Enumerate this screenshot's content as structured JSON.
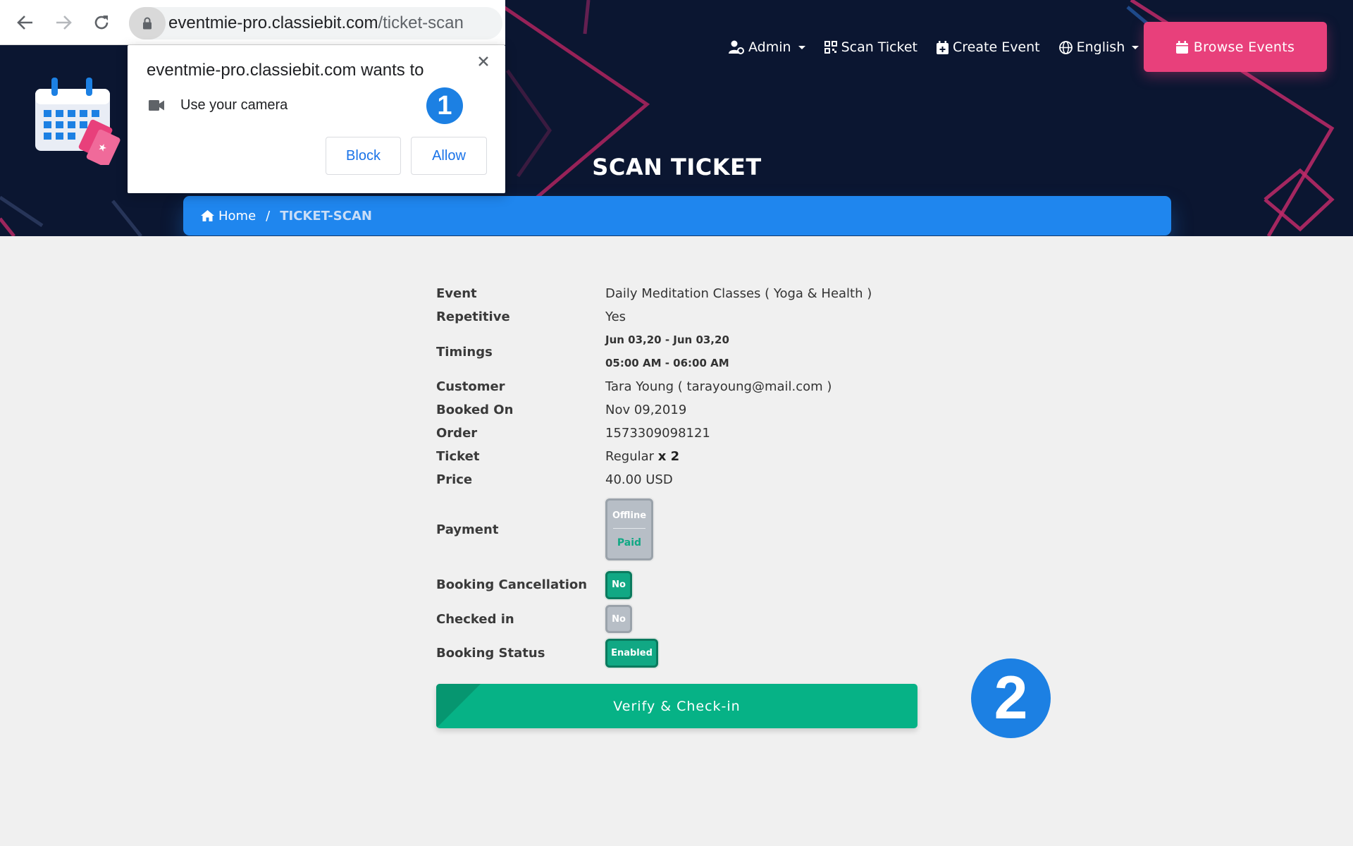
{
  "browser": {
    "url_host": "eventmie-pro.classiebit.com",
    "url_path": "/ticket-scan"
  },
  "permission_popup": {
    "title": "eventmie-pro.classiebit.com wants to",
    "permission_label": "Use your camera",
    "block_label": "Block",
    "allow_label": "Allow",
    "step_badge": "1"
  },
  "nav": {
    "admin_label": "Admin",
    "scan_ticket_label": "Scan Ticket",
    "create_event_label": "Create Event",
    "language_label": "English",
    "browse_events_label": "Browse Events"
  },
  "page": {
    "title": "SCAN TICKET",
    "breadcrumb_home": "Home",
    "breadcrumb_sep": "/",
    "breadcrumb_current": "TICKET-SCAN"
  },
  "details": {
    "event_label": "Event",
    "event_value": "Daily Meditation Classes ( Yoga & Health )",
    "repetitive_label": "Repetitive",
    "repetitive_value": "Yes",
    "timings_label": "Timings",
    "timings_dates": "Jun 03,20 - Jun 03,20",
    "timings_hours": "05:00 AM - 06:00 AM",
    "customer_label": "Customer",
    "customer_value": "Tara Young ( tarayoung@mail.com )",
    "booked_on_label": "Booked On",
    "booked_on_value": "Nov 09,2019",
    "order_label": "Order",
    "order_value": "1573309098121",
    "ticket_label": "Ticket",
    "ticket_type": "Regular",
    "ticket_qty": "x 2",
    "price_label": "Price",
    "price_value": "40.00 USD",
    "payment_label": "Payment",
    "payment_method": "Offline",
    "payment_status": "Paid",
    "cancellation_label": "Booking Cancellation",
    "cancellation_value": "No",
    "checked_in_label": "Checked in",
    "checked_in_value": "No",
    "status_label": "Booking Status",
    "status_value": "Enabled"
  },
  "verify_button_label": "Verify & Check-in",
  "step_badge_2": "2",
  "colors": {
    "header_bg": "#0b1631",
    "accent_pink": "#e8407b",
    "breadcrumb_blue": "#1f86ee",
    "success_green": "#06b286",
    "badge_blue": "#1c80e3"
  }
}
